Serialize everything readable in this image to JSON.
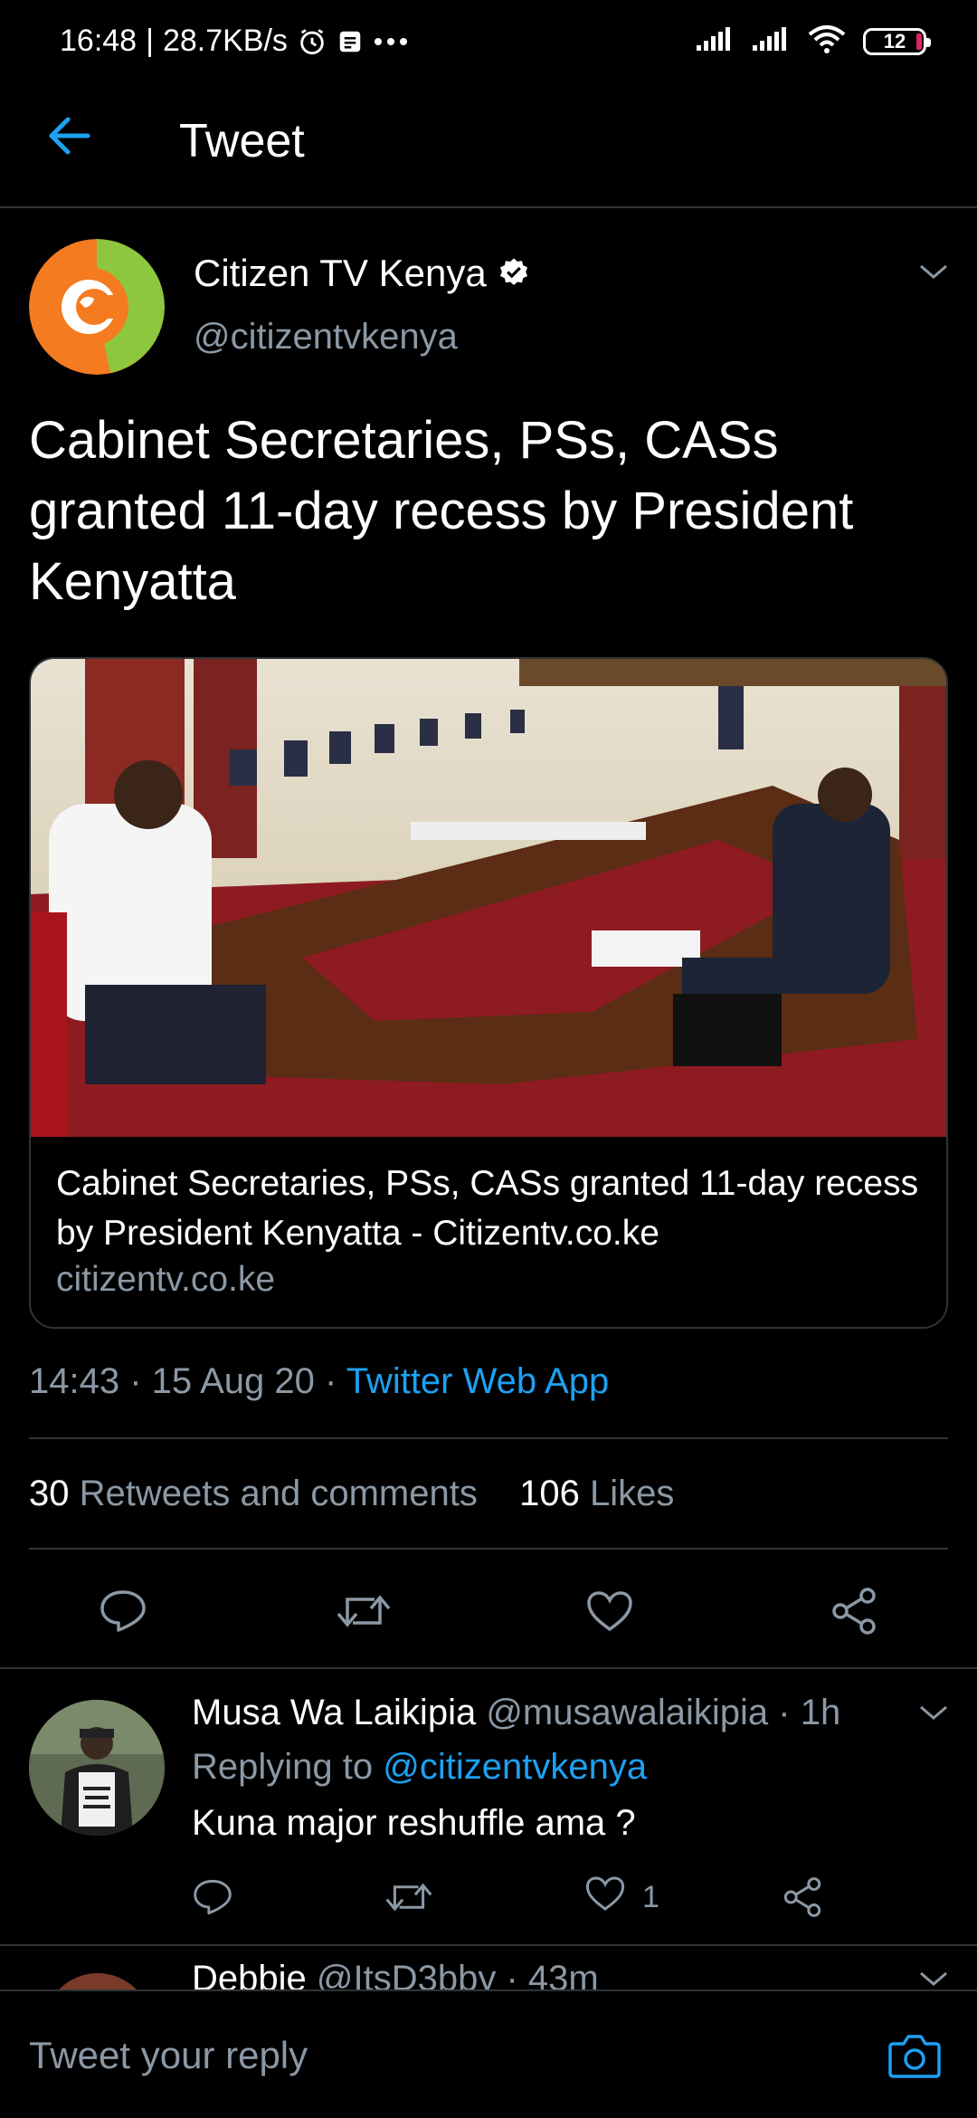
{
  "status_bar": {
    "time": "16:48",
    "speed": "28.7KB/s",
    "battery": "12",
    "icons": [
      "alarm-icon",
      "notification-icon",
      "more-dots-icon",
      "signal-icon",
      "signal-icon",
      "wifi-icon",
      "battery-icon"
    ]
  },
  "header": {
    "title": "Tweet",
    "back_icon": "back-arrow-icon"
  },
  "tweet": {
    "author_name": "Citizen TV Kenya",
    "author_handle": "@citizentvkenya",
    "text": "Cabinet Secretaries, PSs, CASs granted 11-day recess by President Kenyatta",
    "card": {
      "title": "Cabinet Secretaries, PSs, CASs granted 11-day recess by President Kenyatta - Citizentv.co.ke",
      "domain": "citizentv.co.ke"
    },
    "time": "14:43",
    "date": "15 Aug 20",
    "source": "Twitter Web App",
    "retweets_count": "30",
    "retweets_label": "Retweets and comments",
    "likes_count": "106",
    "likes_label": "Likes"
  },
  "reply": {
    "author_name": "Musa Wa Laikipia",
    "author_handle": "@musawalaikipia",
    "age": "1h",
    "replying_prefix": "Replying to",
    "replying_to": "@citizentvkenya",
    "text": "Kuna major reshuffle ama ?",
    "likes": "1"
  },
  "next_reply": {
    "author_name": "Debbie",
    "author_handle": "@ItsD3bby",
    "age": "43m"
  },
  "reply_bar": {
    "placeholder": "Tweet your reply"
  },
  "colors": {
    "accent": "#1da1f2",
    "muted": "#8b98a5",
    "background": "#000000",
    "divider": "#2f3336"
  }
}
